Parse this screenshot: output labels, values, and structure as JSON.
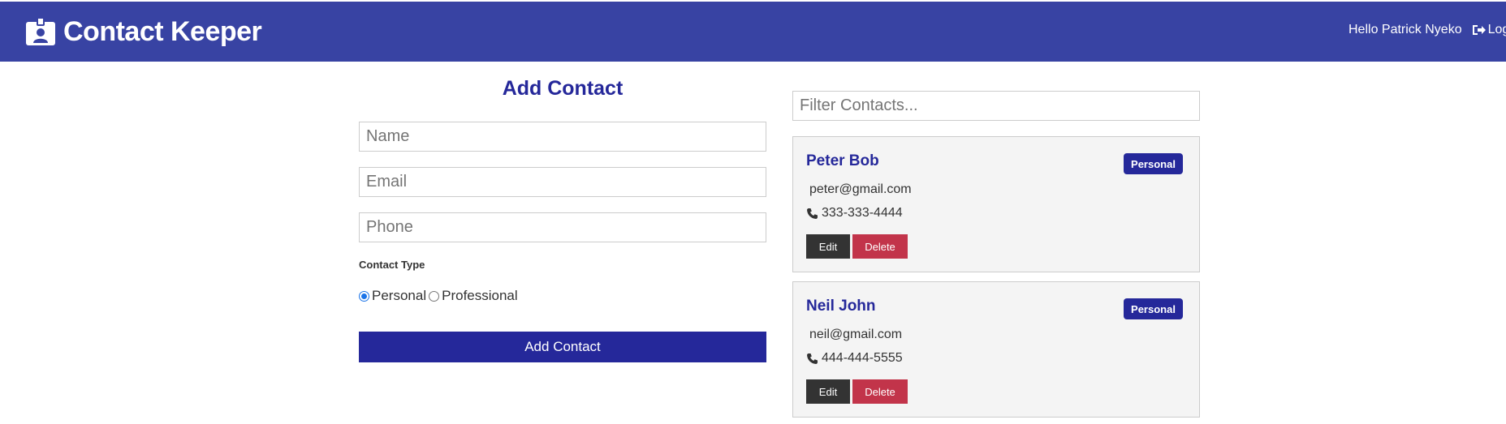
{
  "navbar": {
    "brand_icon": "id-badge-icon",
    "title": "Contact Keeper",
    "greeting": "Hello Patrick Nyeko",
    "logout_icon": "sign-out-icon",
    "logout_label": "Logo"
  },
  "form": {
    "title": "Add Contact",
    "name_placeholder": "Name",
    "email_placeholder": "Email",
    "phone_placeholder": "Phone",
    "type_label": "Contact Type",
    "options": [
      {
        "label": "Personal",
        "checked": true
      },
      {
        "label": "Professional",
        "checked": false
      }
    ],
    "submit_label": "Add Contact"
  },
  "filter": {
    "placeholder": "Filter Contacts..."
  },
  "contacts": [
    {
      "name": "Peter Bob",
      "type": "Personal",
      "email": "peter@gmail.com",
      "phone": "333-333-4444",
      "edit_label": "Edit",
      "delete_label": "Delete"
    },
    {
      "name": "Neil John",
      "type": "Personal",
      "email": "neil@gmail.com",
      "phone": "444-444-5555",
      "edit_label": "Edit",
      "delete_label": "Delete"
    }
  ],
  "colors": {
    "navbar": "#3843a3",
    "primary": "#25289a",
    "danger": "#c2344a",
    "dark": "#333333",
    "card_bg": "#f4f4f4"
  }
}
